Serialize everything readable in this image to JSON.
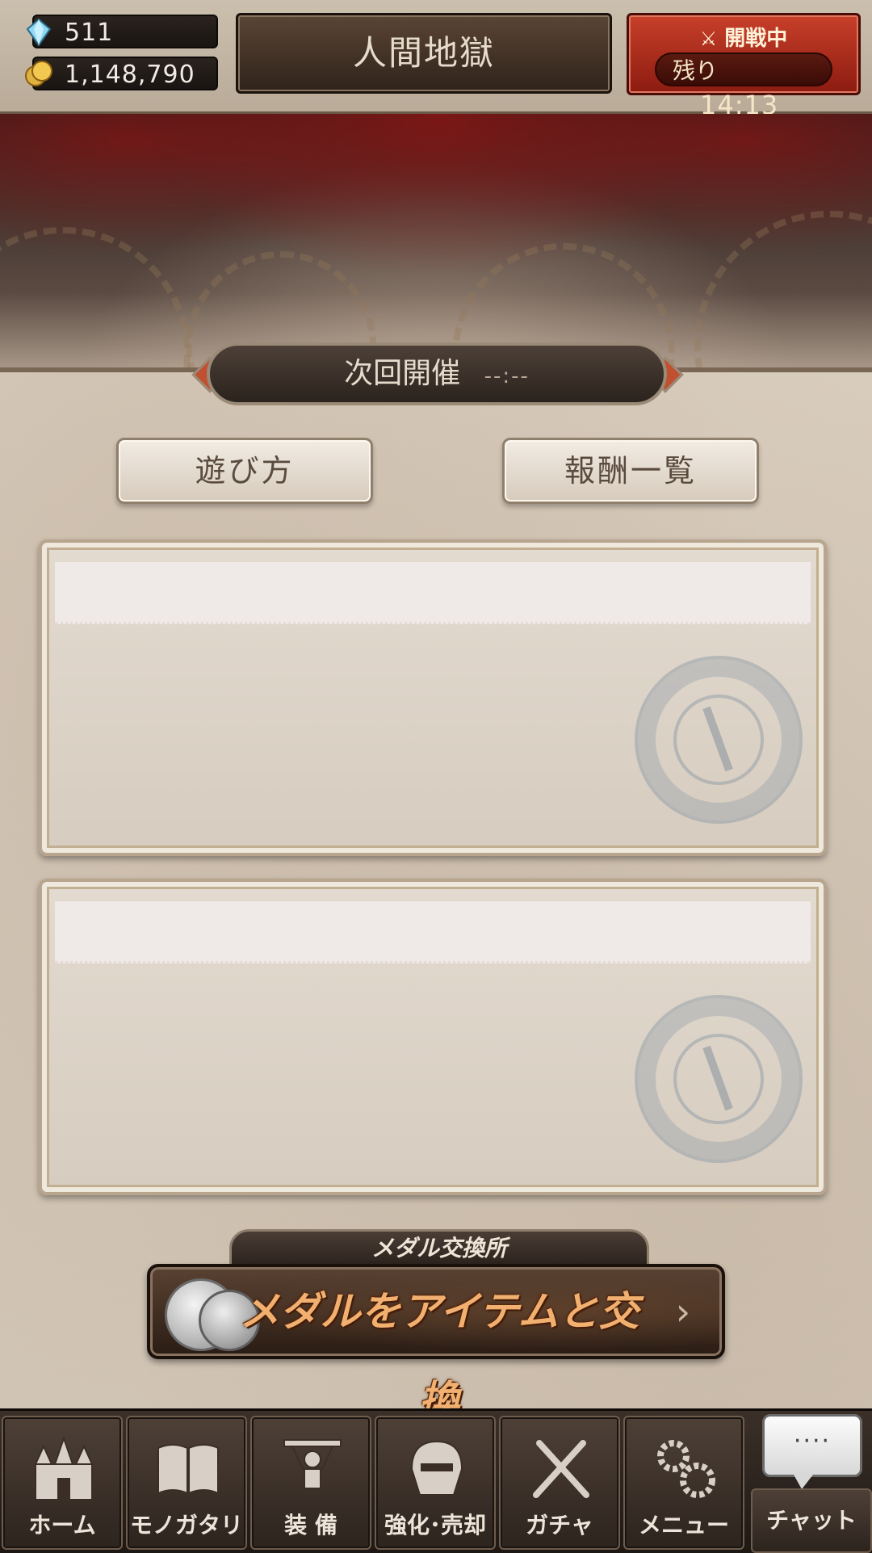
{
  "header": {
    "gems": "511",
    "gold": "1,148,790",
    "title": "人間地獄",
    "battle_status": "開戦中",
    "remaining_label": "残り",
    "remaining_time": "14:13"
  },
  "next_event": {
    "label": "次回開催",
    "time": "--:--"
  },
  "buttons": {
    "how_to_play": "遊び方",
    "rewards": "報酬一覧"
  },
  "medal_exchange": {
    "label": "メダル交換所",
    "button": "メダルをアイテムと交換",
    "arrow": "›"
  },
  "nav": {
    "items": [
      {
        "label": "ホーム",
        "icon": "castle-icon"
      },
      {
        "label": "モノガタリ",
        "icon": "book-icon"
      },
      {
        "label": "装 備",
        "icon": "puppet-icon"
      },
      {
        "label": "強化･売却",
        "icon": "helmet-icon"
      },
      {
        "label": "ガチャ",
        "icon": "crossed-swords-icon"
      },
      {
        "label": "メニュー",
        "icon": "gears-icon"
      }
    ],
    "chat": {
      "bubble": "····",
      "label": "チャット"
    }
  },
  "colors": {
    "battle_red": "#b42f1f",
    "medal_text": "#f2b070",
    "parchment": "#d8cdbf"
  }
}
